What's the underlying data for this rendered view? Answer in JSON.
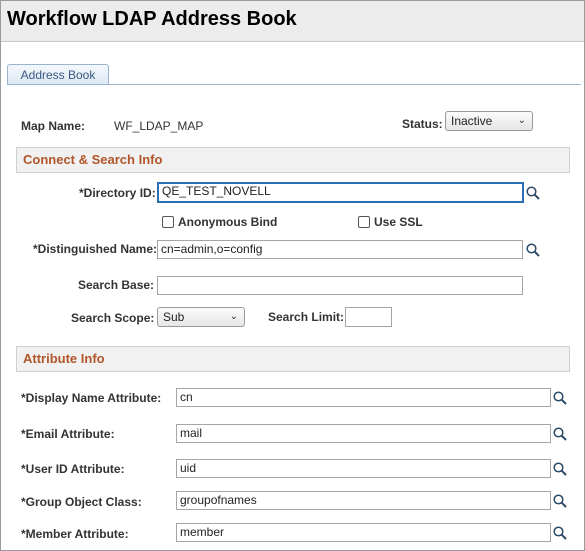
{
  "page": {
    "title": "Workflow LDAP Address Book"
  },
  "tabs": [
    {
      "label": "Address Book"
    }
  ],
  "map": {
    "label": "Map Name:",
    "value": "WF_LDAP_MAP"
  },
  "status": {
    "label": "Status:",
    "value": "Inactive"
  },
  "connect_section": {
    "title": "Connect & Search Info",
    "directory_id": {
      "label": "*Directory ID:",
      "value": "QE_TEST_NOVELL"
    },
    "anonymous_bind": {
      "label": "Anonymous Bind",
      "checked": false
    },
    "use_ssl": {
      "label": "Use SSL",
      "checked": false
    },
    "distinguished_name": {
      "label": "*Distinguished Name:",
      "value": "cn=admin,o=config"
    },
    "search_base": {
      "label": "Search Base:",
      "value": ""
    },
    "search_scope": {
      "label": "Search Scope:",
      "value": "Sub"
    },
    "search_limit": {
      "label": "Search Limit:",
      "value": ""
    }
  },
  "attribute_section": {
    "title": "Attribute Info",
    "display_name": {
      "label": "*Display Name Attribute:",
      "value": "cn"
    },
    "email": {
      "label": "*Email Attribute:",
      "value": "mail"
    },
    "user_id": {
      "label": "*User ID Attribute:",
      "value": "uid"
    },
    "group_object_class": {
      "label": "*Group Object Class:",
      "value": "groupofnames"
    },
    "member": {
      "label": "*Member Attribute:",
      "value": "member"
    }
  },
  "icons": {
    "lookup": "magnifier-icon",
    "dropdown": "chevron-down-icon"
  }
}
